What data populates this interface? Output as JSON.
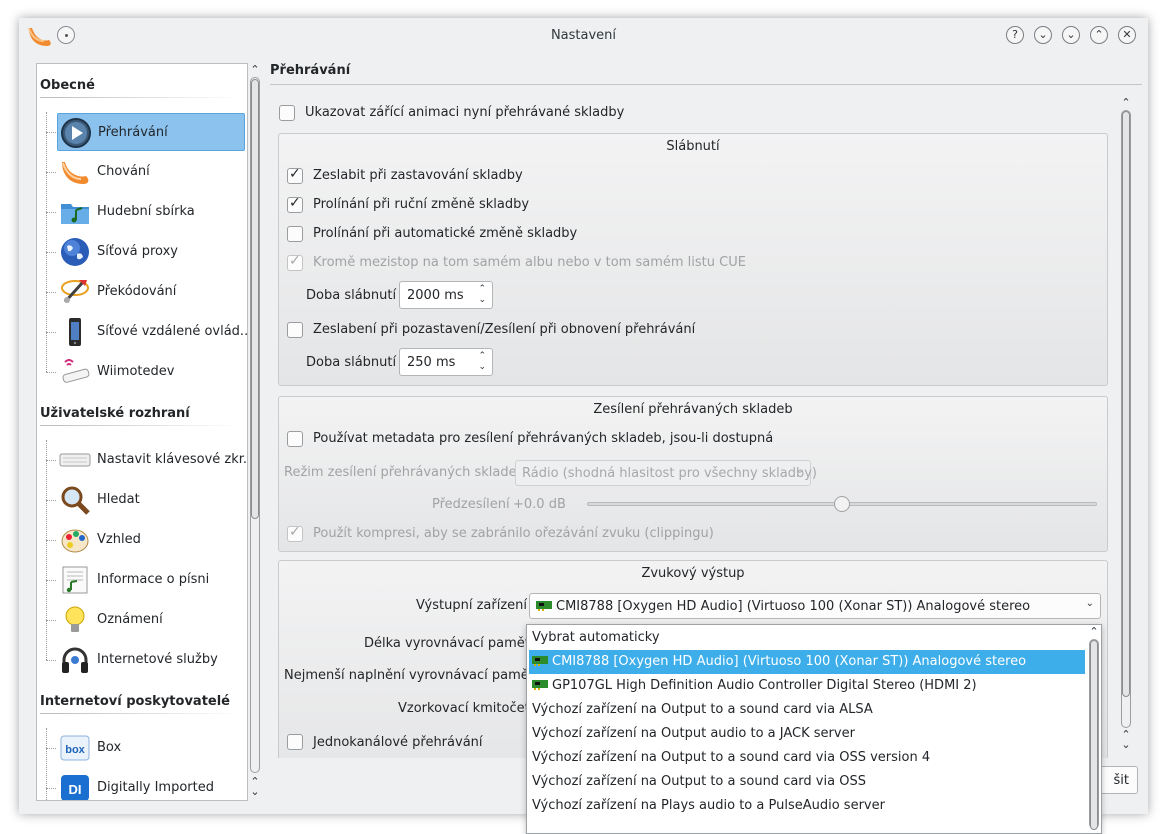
{
  "window": {
    "title": "Nastavení"
  },
  "titlebar_buttons": [
    "?",
    "⌄",
    "⌄",
    "⌃",
    "✕"
  ],
  "sidebar": {
    "categories": [
      {
        "title": "Obecné",
        "items": [
          {
            "label": "Přehrávání",
            "icon": "play-icon",
            "selected": true
          },
          {
            "label": "Chování",
            "icon": "clementine-icon"
          },
          {
            "label": "Hudební sbírka",
            "icon": "music-folder-icon"
          },
          {
            "label": "Síťová proxy",
            "icon": "globe-icon"
          },
          {
            "label": "Překódování",
            "icon": "transcode-icon"
          },
          {
            "label": "Síťové vzdálené ovlád...",
            "icon": "phone-icon"
          },
          {
            "label": "Wiimotedev",
            "icon": "wiimote-icon"
          }
        ]
      },
      {
        "title": "Uživatelské rozhraní",
        "items": [
          {
            "label": "Nastavit klávesové zkr...",
            "icon": "keyboard-icon"
          },
          {
            "label": "Hledat",
            "icon": "magnifier-icon"
          },
          {
            "label": "Vzhled",
            "icon": "palette-icon"
          },
          {
            "label": "Informace o písni",
            "icon": "song-info-icon"
          },
          {
            "label": "Oznámení",
            "icon": "lightbulb-icon"
          },
          {
            "label": "Internetové služby",
            "icon": "headphones-icon"
          }
        ]
      },
      {
        "title": "Internetoví poskytovatelé",
        "items": [
          {
            "label": "Box",
            "icon": "box-icon"
          },
          {
            "label": "Digitally Imported",
            "icon": "di-icon"
          }
        ]
      }
    ]
  },
  "page": {
    "title": "Přehrávání",
    "glow_animation": {
      "label": "Ukazovat zářící animaci nyní přehrávané skladby",
      "checked": false
    },
    "fade": {
      "title": "Slábnutí",
      "fade_on_stop": {
        "label": "Zeslabit při zastavování skladby",
        "checked": true
      },
      "crossfade_manual": {
        "label": "Prolínání při ruční změně skladby",
        "checked": true
      },
      "crossfade_auto": {
        "label": "Prolínání při automatické změně skladby",
        "checked": false
      },
      "except_same_album": {
        "label": "Kromě mezistop na tom samém albu nebo v tom samém listu CUE",
        "checked": true,
        "disabled": true
      },
      "fade_duration_label": "Doba slábnutí",
      "fade_duration_value": "2000 ms",
      "fade_on_pause": {
        "label": "Zeslabení při pozastavení/Zesílení při obnovení přehrávání",
        "checked": false
      },
      "pause_fade_duration_label": "Doba slábnutí",
      "pause_fade_duration_value": "250 ms"
    },
    "replaygain": {
      "title": "Zesílení přehrávaných skladeb",
      "use_metadata": {
        "label": "Používat metadata pro zesílení přehrávaných skladeb, jsou-li dostupná",
        "checked": false
      },
      "mode_label": "Režim zesílení přehrávaných skladeb",
      "mode_value": "Rádio (shodná hlasitost pro všechny skladby)",
      "preamp_label": "Předzesílení",
      "preamp_value": "+0.0 dB",
      "preamp_level": 0.5,
      "compression": {
        "label": "Použít kompresi, aby se zabránilo ořezávání zvuku (clippingu)",
        "checked": true,
        "disabled": true
      }
    },
    "output": {
      "title": "Zvukový výstup",
      "device_label": "Výstupní zařízení",
      "device_value": "CMI8788 [Oxygen HD Audio] (Virtuoso 100 (Xonar ST)) Analogové stereo",
      "buffer_label": "Délka vyrovnávací paměti",
      "min_buffer_label": "Nejmenší naplnění vyrovnávací paměti",
      "sample_rate_label": "Vzorkovací kmitočet",
      "mono": {
        "label": "Jednokanálové přehrávání",
        "checked": false
      }
    }
  },
  "bottom_button_label": "šit",
  "dropdown": {
    "options": [
      {
        "label": "Vybrat automaticky",
        "icon": ""
      },
      {
        "label": "CMI8788 [Oxygen HD Audio] (Virtuoso 100 (Xonar ST)) Analogové stereo",
        "icon": "sound-card-icon",
        "selected": true
      },
      {
        "label": "GP107GL High Definition Audio Controller Digital Stereo (HDMI 2)",
        "icon": "sound-card-icon"
      },
      {
        "label": "Výchozí zařízení na Output to a sound card via ALSA",
        "icon": ""
      },
      {
        "label": "Výchozí zařízení na Output audio to a JACK server",
        "icon": ""
      },
      {
        "label": "Výchozí zařízení na Output to a sound card via OSS version 4",
        "icon": ""
      },
      {
        "label": "Výchozí zařízení na Output to a sound card via OSS",
        "icon": ""
      },
      {
        "label": "Výchozí zařízení na Plays audio to a PulseAudio server",
        "icon": ""
      }
    ]
  },
  "colors": {
    "selection": "#3daee9",
    "sidebar_selection": "#8cc2ee",
    "window_bg": "#eff0f1"
  }
}
